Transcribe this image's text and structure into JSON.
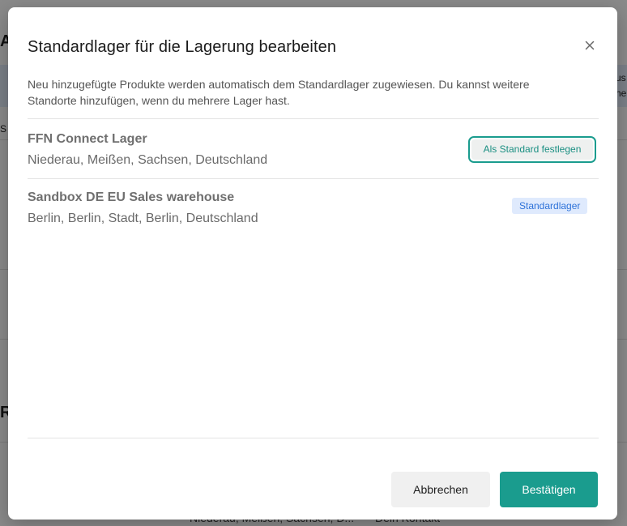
{
  "background": {
    "left_heading_letter_top": "A",
    "left_heading_letter_bottom": "R",
    "left_small_text": "S",
    "right_edge_text_1": "us",
    "right_edge_text_2": "he",
    "bottom_row_address": "Niederau, Meißen, Sachsen, D...",
    "bottom_row_contact": "Dein Kontakt"
  },
  "modal": {
    "title": "Standardlager für die Lagerung bearbeiten",
    "close_icon": "close-icon",
    "description": "Neu hinzugefügte Produkte werden automatisch dem Standardlager zugewiesen. Du kannst weitere Standorte hinzufügen, wenn du mehrere Lager hast.",
    "warehouses": [
      {
        "name": "FFN Connect Lager",
        "address": "Niederau, Meißen, Sachsen, Deutschland",
        "action_label": "Als Standard festlegen"
      },
      {
        "name": "Sandbox DE EU Sales warehouse",
        "address": "Berlin, Berlin, Stadt, Berlin, Deutschland",
        "badge_label": "Standardlager"
      }
    ],
    "footer": {
      "cancel_label": "Abbrechen",
      "confirm_label": "Bestätigen"
    }
  },
  "colors": {
    "accent": "#1a9c8e",
    "badge_bg": "#dfeafd",
    "badge_text": "#2e72d9"
  }
}
